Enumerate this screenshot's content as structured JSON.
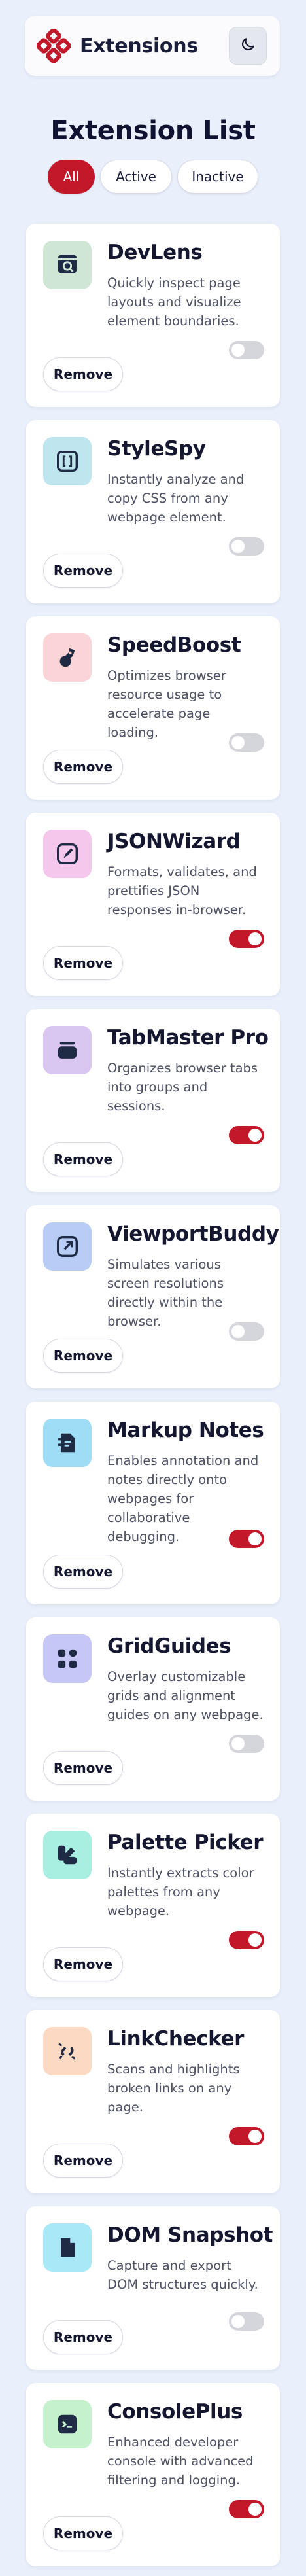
{
  "header": {
    "title": "Extensions",
    "logo_icon": "logo-icon",
    "theme_icon": "moon-icon"
  },
  "page": {
    "title": "Extension List"
  },
  "filters": [
    {
      "label": "All",
      "active": true
    },
    {
      "label": "Active",
      "active": false
    },
    {
      "label": "Inactive",
      "active": false
    }
  ],
  "colors": {
    "accent": "#c3172a",
    "background": "#eaf0fb",
    "toggle_off": "#d4d6dc"
  },
  "remove_label": "Remove",
  "extensions": [
    {
      "name": "DevLens",
      "description": "Quickly inspect page layouts and visualize element boundaries.",
      "active": false,
      "icon": "inspect-icon",
      "tile_color": "#cfe6d4",
      "icon_color": "#1f2a44"
    },
    {
      "name": "StyleSpy",
      "description": "Instantly analyze and copy CSS from any webpage element.",
      "active": false,
      "icon": "css-brackets-icon",
      "tile_color": "#bfe6ef",
      "icon_color": "#1f2a44"
    },
    {
      "name": "SpeedBoost",
      "description": "Optimizes browser resource usage to accelerate page loading.",
      "active": false,
      "icon": "rocket-icon",
      "tile_color": "#fbd4d8",
      "icon_color": "#1f2a44"
    },
    {
      "name": "JSONWizard",
      "description": "Formats, validates, and prettifies JSON responses in-browser.",
      "active": true,
      "icon": "code-edit-icon",
      "tile_color": "#f5c7ec",
      "icon_color": "#1f2a44"
    },
    {
      "name": "TabMaster Pro",
      "description": "Organizes browser tabs into groups and sessions.",
      "active": true,
      "icon": "tab-stack-icon",
      "tile_color": "#d9c7f2",
      "icon_color": "#1f2a44"
    },
    {
      "name": "ViewportBuddy",
      "description": "Simulates various screen resolutions directly within the browser.",
      "active": false,
      "icon": "external-link-icon",
      "tile_color": "#b7cdf5",
      "icon_color": "#1f2a44"
    },
    {
      "name": "Markup Notes",
      "description": "Enables annotation and notes directly onto webpages for collaborative debugging.",
      "active": true,
      "icon": "note-icon",
      "tile_color": "#9fdcf5",
      "icon_color": "#1f2a44"
    },
    {
      "name": "GridGuides",
      "description": "Overlay customizable grids and alignment guides on any webpage.",
      "active": false,
      "icon": "grid-icon",
      "tile_color": "#c6c6f7",
      "icon_color": "#1f2a44"
    },
    {
      "name": "Palette Picker",
      "description": "Instantly extracts color palettes from any webpage.",
      "active": true,
      "icon": "palette-icon",
      "tile_color": "#a9efe1",
      "icon_color": "#1f2a44"
    },
    {
      "name": "LinkChecker",
      "description": "Scans and highlights broken links on any page.",
      "active": true,
      "icon": "broken-link-icon",
      "tile_color": "#fcd9c3",
      "icon_color": "#1f2a44"
    },
    {
      "name": "DOM Snapshot",
      "description": "Capture and export DOM structures quickly.",
      "active": false,
      "icon": "document-icon",
      "tile_color": "#a8e8f7",
      "icon_color": "#1f2a44"
    },
    {
      "name": "ConsolePlus",
      "description": "Enhanced developer console with advanced filtering and logging.",
      "active": true,
      "icon": "terminal-icon",
      "tile_color": "#c5f2cc",
      "icon_color": "#1f2a44"
    }
  ]
}
